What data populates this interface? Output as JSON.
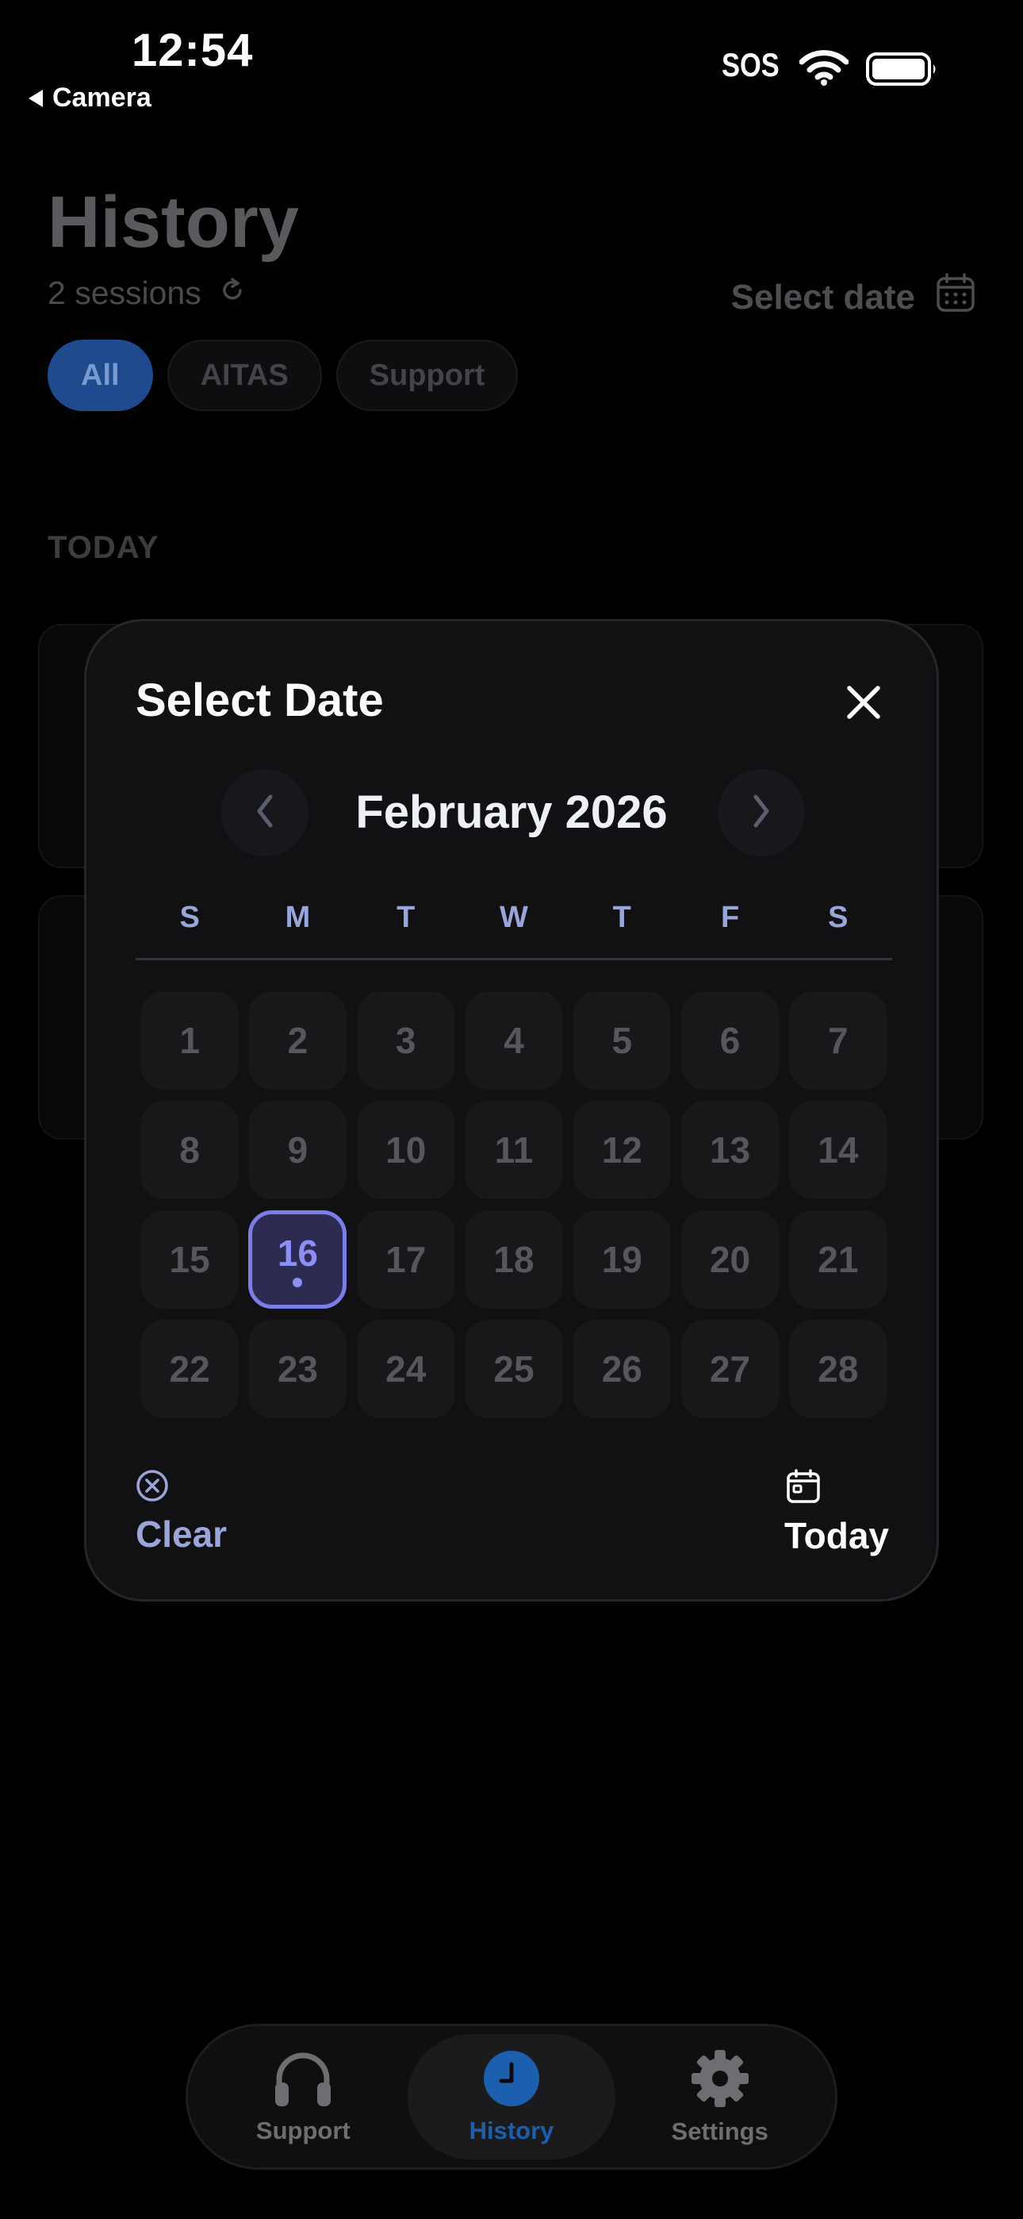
{
  "status_bar": {
    "time": "12:54",
    "back_label": "Camera",
    "carrier": "SOS"
  },
  "history": {
    "title": "History",
    "sessions_text": "2 sessions",
    "select_date_label": "Select date",
    "filters": [
      "All",
      "AITAS",
      "Support"
    ],
    "active_filter": "All",
    "section_label": "TODAY"
  },
  "date_modal": {
    "title": "Select Date",
    "month_label": "February 2026",
    "weekdays": [
      "S",
      "M",
      "T",
      "W",
      "T",
      "F",
      "S"
    ],
    "days": [
      "1",
      "2",
      "3",
      "4",
      "5",
      "6",
      "7",
      "8",
      "9",
      "10",
      "11",
      "12",
      "13",
      "14",
      "15",
      "16",
      "17",
      "18",
      "19",
      "20",
      "21",
      "22",
      "23",
      "24",
      "25",
      "26",
      "27",
      "28"
    ],
    "selected_day": "16",
    "clear_label": "Clear",
    "today_label": "Today"
  },
  "tabbar": {
    "items": [
      {
        "label": "Support",
        "icon": "headphones-icon"
      },
      {
        "label": "History",
        "icon": "clock-icon"
      },
      {
        "label": "Settings",
        "icon": "gear-icon"
      }
    ],
    "active": "History"
  },
  "colors": {
    "background": "#000000",
    "modal_bg": "#111114",
    "accent_selected": "#7b7ee8",
    "accent_blue": "#1c5fae",
    "weekday_text": "#9aa6da"
  }
}
